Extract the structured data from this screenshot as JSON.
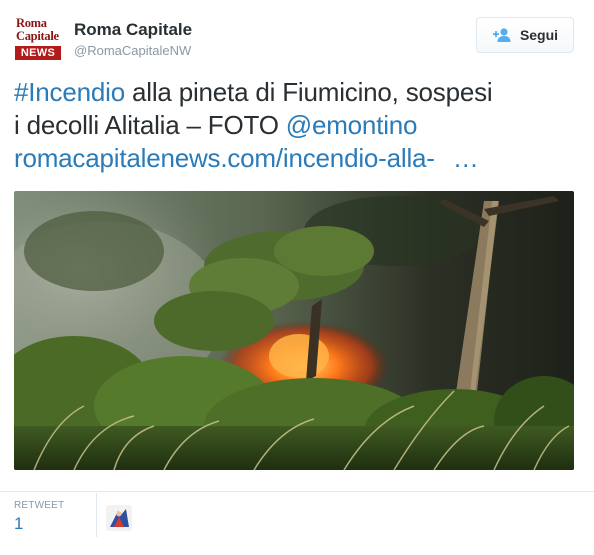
{
  "account": {
    "logo_line1": "Roma",
    "logo_line2": "Capitale",
    "logo_line3": "NEWS",
    "name": "Roma Capitale",
    "handle": "@RomaCapitaleNW",
    "follow_label": "Segui",
    "follow_icon": "add-user-icon"
  },
  "tweet": {
    "hashtag": "#Incendio",
    "text_part1": " alla pineta di Fiumicino, sospesi",
    "text_part2": "i decolli Alitalia – FOTO ",
    "mention": "@emontino",
    "link": "romacapitalenews.com/incendio-alla-",
    "link_ellipsis": "…"
  },
  "photo": {
    "description_icon": "wildfire-pine-forest-photo"
  },
  "stats": {
    "retweet_label": "RETWEET",
    "retweet_count": "1"
  },
  "colors": {
    "link": "#2b7bb9",
    "text": "#292f33",
    "muted": "#8899a6",
    "border": "#e1e8ed",
    "brand_red": "#b31b1b"
  }
}
